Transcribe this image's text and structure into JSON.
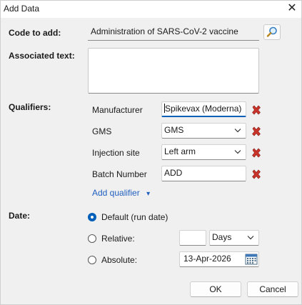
{
  "window": {
    "title": "Add Data",
    "close_glyph": "✕"
  },
  "code": {
    "label": "Code to add:",
    "value": "Administration of SARS-CoV-2 vaccine",
    "search_icon": "magnifier-icon"
  },
  "associated": {
    "label": "Associated text:",
    "value": ""
  },
  "qualifiers": {
    "label": "Qualifiers:",
    "rows": [
      {
        "label": "Manufacturer",
        "value": "Spikevax (Moderna)",
        "kind": "text"
      },
      {
        "label": "GMS",
        "value": "GMS",
        "kind": "combo"
      },
      {
        "label": "Injection site",
        "value": "Left arm",
        "kind": "combo"
      },
      {
        "label": "Batch Number",
        "value": "ADD",
        "kind": "text"
      }
    ],
    "add_link": "Add qualifier",
    "add_dropdown_glyph": "▾",
    "delete_icon": "red-x-icon",
    "delete_color": "#c0392b"
  },
  "date": {
    "label": "Date:",
    "options": {
      "default": "Default (run date)",
      "relative": "Relative:",
      "absolute": "Absolute:"
    },
    "selected": "default",
    "relative_amount": "",
    "relative_unit": "Days",
    "absolute_value": "13-Apr-2026"
  },
  "buttons": {
    "ok": "OK",
    "cancel": "Cancel"
  },
  "colors": {
    "accent": "#005fb8",
    "link": "#1f5fbf"
  }
}
